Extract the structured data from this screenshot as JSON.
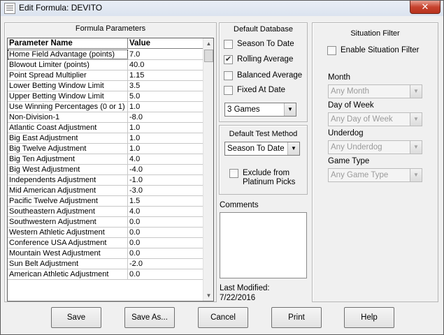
{
  "window": {
    "title": "Edit Formula:  DEVITO",
    "close_label": "✕"
  },
  "formula_parameters": {
    "group_title": "Formula Parameters",
    "columns": [
      "Parameter Name",
      "Value"
    ],
    "rows": [
      {
        "name": "Home Field Advantage (points)",
        "value": "7.0"
      },
      {
        "name": "Blowout Limiter (points)",
        "value": "40.0"
      },
      {
        "name": "Point Spread Multiplier",
        "value": "1.15"
      },
      {
        "name": "Lower Betting Window Limit",
        "value": "3.5"
      },
      {
        "name": "Upper Betting Window Limit",
        "value": "5.0"
      },
      {
        "name": "Use Winning Percentages (0 or 1)",
        "value": "1.0"
      },
      {
        "name": "Non-Division-1",
        "value": "-8.0"
      },
      {
        "name": "Atlantic Coast Adjustment",
        "value": "1.0"
      },
      {
        "name": "Big East Adjustment",
        "value": "1.0"
      },
      {
        "name": "Big Twelve Adjustment",
        "value": "1.0"
      },
      {
        "name": "Big Ten Adjustment",
        "value": "4.0"
      },
      {
        "name": "Big West Adjustment",
        "value": "-4.0"
      },
      {
        "name": "Independents Adjustment",
        "value": "-1.0"
      },
      {
        "name": "Mid American Adjustment",
        "value": "-3.0"
      },
      {
        "name": "Pacific Twelve Adjustment",
        "value": "1.5"
      },
      {
        "name": "Southeastern Adjustment",
        "value": "4.0"
      },
      {
        "name": "Southwestern Adjustment",
        "value": "0.0"
      },
      {
        "name": "Western Athletic Adjustment",
        "value": "0.0"
      },
      {
        "name": "Conference USA Adjustment",
        "value": "0.0"
      },
      {
        "name": "Mountain West Adjustment",
        "value": "0.0"
      },
      {
        "name": "Sun Belt Adjustment",
        "value": "-2.0"
      },
      {
        "name": "American Athletic Adjustment",
        "value": "0.0"
      }
    ]
  },
  "default_database": {
    "group_title": "Default Database",
    "options": [
      {
        "label": "Season To Date",
        "checked": false
      },
      {
        "label": "Rolling Average",
        "checked": true
      },
      {
        "label": "Balanced Average",
        "checked": false
      },
      {
        "label": "Fixed At Date",
        "checked": false
      }
    ],
    "games_select": "3 Games"
  },
  "default_test_method": {
    "group_title": "Default Test Method",
    "method_select": "Season To Date",
    "exclude_label_line1": "Exclude from",
    "exclude_label_line2": "Platinum Picks",
    "exclude_checked": false
  },
  "comments": {
    "label": "Comments",
    "value": ""
  },
  "last_modified": {
    "label": "Last Modified:",
    "date": "7/22/2016"
  },
  "situation_filter": {
    "group_title": "Situation Filter",
    "enable_label": "Enable Situation Filter",
    "enable_checked": false,
    "filters": [
      {
        "label": "Month",
        "value": "Any Month"
      },
      {
        "label": "Day of Week",
        "value": "Any Day of Week"
      },
      {
        "label": "Underdog",
        "value": "Any Underdog"
      },
      {
        "label": "Game Type",
        "value": "Any Game Type"
      }
    ]
  },
  "buttons": {
    "save": "Save",
    "save_as": "Save As...",
    "cancel": "Cancel",
    "print": "Print",
    "help": "Help"
  },
  "glyphs": {
    "check": "✔",
    "arrow_up": "▲",
    "arrow_down": "▼"
  }
}
